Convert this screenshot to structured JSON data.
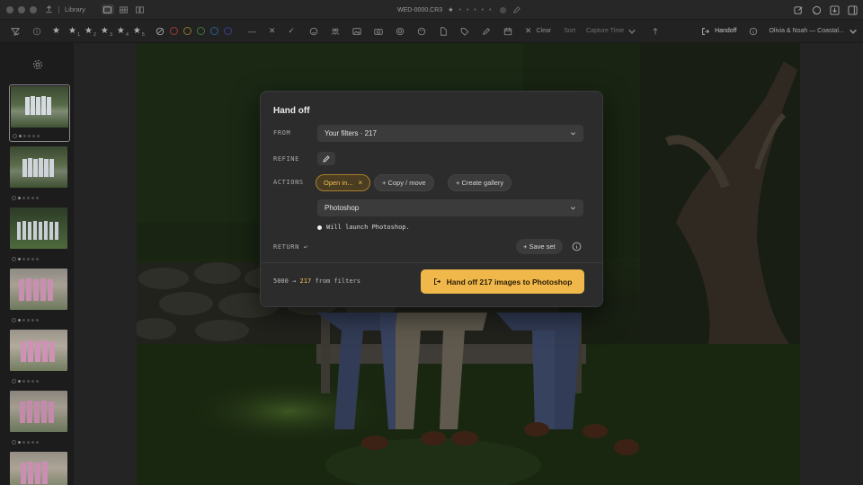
{
  "titlebar": {
    "library_label": "Library",
    "filename": "WED-0000.CR3",
    "rating_star": "★",
    "rating_dots": "• • • • •"
  },
  "filterbar": {
    "stars": [
      {
        "glyph": "★",
        "sub": ""
      },
      {
        "glyph": "★",
        "sub": "1"
      },
      {
        "glyph": "★",
        "sub": "2"
      },
      {
        "glyph": "★",
        "sub": "3"
      },
      {
        "glyph": "★",
        "sub": "4"
      },
      {
        "glyph": "★",
        "sub": "5"
      }
    ],
    "color_labels": [
      "#a33a35",
      "#8c7a27",
      "#3d7a3a",
      "#2e5e8f",
      "#3b3f8f"
    ],
    "flag_minus": "—",
    "flag_reject": "✕",
    "flag_pick": "✓",
    "clear_label": "Clear",
    "sort_label": "Sort",
    "sort_value": "Capture Time",
    "handoff_label": "Handoff",
    "session_label": "Olivia & Noah — Coastal..."
  },
  "modal": {
    "title": "Hand off",
    "from_label": "FROM",
    "from_value": "Your filters · 217",
    "refine_label": "REFINE",
    "actions_label": "ACTIONS",
    "actions": [
      {
        "label": "Open in...",
        "active": true,
        "remove": "×"
      },
      {
        "label": "+ Copy / move",
        "active": false
      },
      {
        "label": "+ Create gallery",
        "active": false
      }
    ],
    "app_value": "Photoshop",
    "note": "Will launch Photoshop.",
    "return_label": "RETURN ↩",
    "save_set_label": "+ Save set",
    "summary_total": "5000",
    "summary_arrow": "→",
    "summary_count": "217",
    "summary_suffix": "from filters",
    "primary_label": "Hand off 217 images to Photoshop"
  },
  "colors": {
    "accent": "#f0b84a",
    "chip_active_text": "#f2be54",
    "panel": "#2c2c2d",
    "control": "#3b3b3c"
  }
}
